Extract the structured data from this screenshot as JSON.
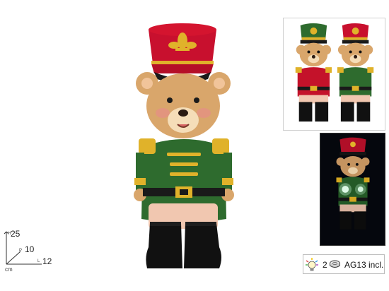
{
  "product": {
    "dimensions": {
      "height_value": "25",
      "height_axis": "H",
      "depth_value": "10",
      "depth_axis": "P",
      "length_value": "12",
      "length_axis": "L",
      "unit": "cm"
    },
    "battery": {
      "quantity": "2",
      "type_label": "AG13 incl."
    }
  },
  "icons": [
    "light-bulb-icon",
    "button-cell-battery-icon"
  ],
  "colors": {
    "hat_red": "#c8102e",
    "jacket_green": "#2e6b2e",
    "jacket_red": "#c4122a",
    "gold": "#e0b22a",
    "boot_black": "#111111",
    "bear_tan": "#d9a66b"
  }
}
